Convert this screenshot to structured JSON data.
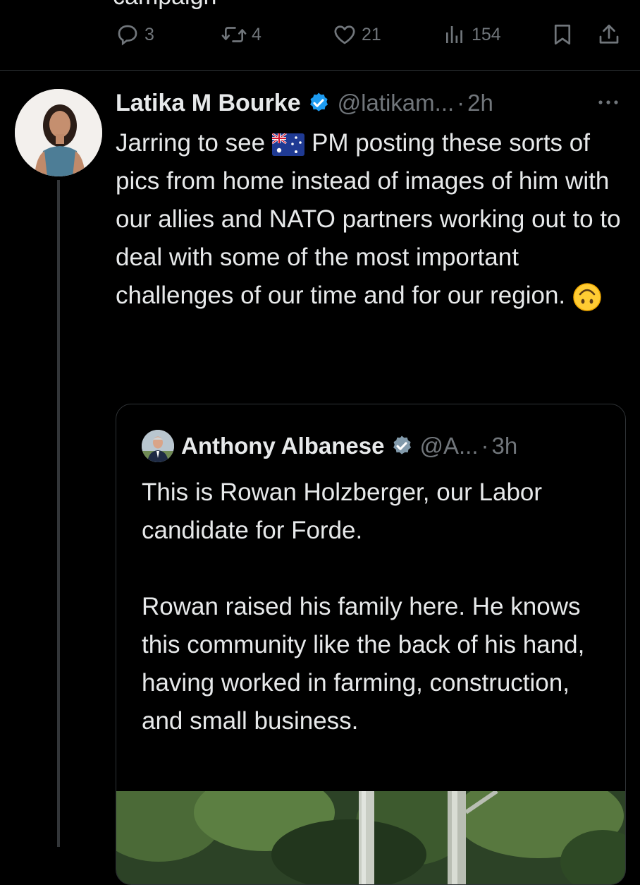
{
  "previous_tweet": {
    "text_sliver": "campaign",
    "actions": {
      "replies": "3",
      "reposts": "4",
      "likes": "21",
      "views": "154"
    }
  },
  "tweet": {
    "author_name": "Latika M Bourke",
    "handle": "@latikam...",
    "separator": "·",
    "time": "2h",
    "text_before_flag": "Jarring to see",
    "text_after_flag": "PM posting these sorts of pics from home instead of images of him with our allies and NATO partners working out to to deal with some of the most important challenges of our time and for our region.",
    "flag_icon": "australia-flag-emoji",
    "emoji_icon": "upside-down-face-emoji"
  },
  "quoted_tweet": {
    "author_name": "Anthony Albanese",
    "handle": "@A...",
    "separator": "·",
    "time": "3h",
    "paragraph_1": "This is Rowan Holzberger, our Labor candidate for Forde.",
    "paragraph_2": "Rowan raised his family here. He knows this community like the back of his hand, having worked in farming, construction, and small business."
  },
  "colors": {
    "background": "#000000",
    "text_primary": "#e7e9ea",
    "text_secondary": "#71767b",
    "border": "#2f3336",
    "verified_blue": "#1d9bf0",
    "verified_grey": "#829aab"
  }
}
